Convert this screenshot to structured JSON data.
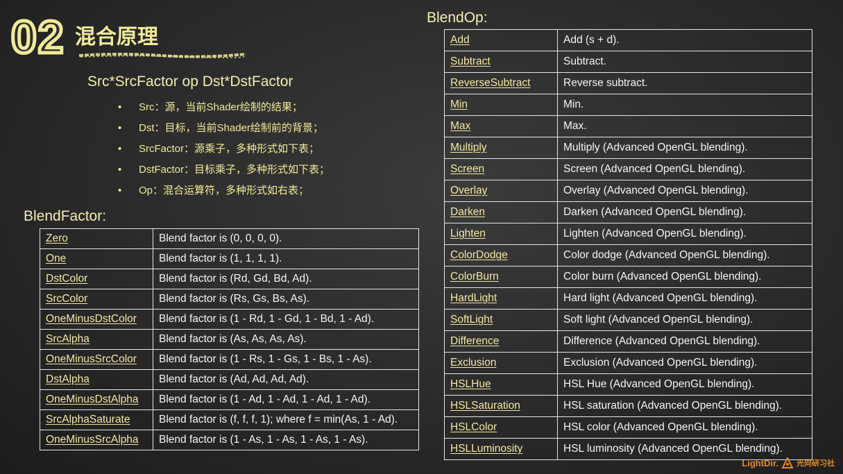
{
  "slide": {
    "number": "02",
    "title": "混合原理",
    "formula": "Src*SrcFactor  op  Dst*DstFactor",
    "bullets": [
      "Src：源，当前Shader绘制的结果；",
      "Dst：目标，当前Shader绘制前的背景；",
      "SrcFactor：源乘子，多种形式如下表；",
      "DstFactor：目标乘子，多种形式如下表；",
      "Op：混合运算符，多种形式如右表；"
    ],
    "bullet_symbol": "•"
  },
  "blend_factor": {
    "heading": "BlendFactor:",
    "rows": [
      {
        "name": "Zero",
        "desc": "Blend factor is (0, 0, 0, 0)."
      },
      {
        "name": "One",
        "desc": "Blend factor is (1, 1, 1, 1)."
      },
      {
        "name": "DstColor",
        "desc": "Blend factor is (Rd, Gd, Bd, Ad)."
      },
      {
        "name": "SrcColor",
        "desc": "Blend factor is (Rs, Gs, Bs, As)."
      },
      {
        "name": "OneMinusDstColor",
        "desc": "Blend factor is (1 - Rd, 1 - Gd, 1 - Bd, 1 - Ad)."
      },
      {
        "name": "SrcAlpha",
        "desc": "Blend factor is (As, As, As, As)."
      },
      {
        "name": "OneMinusSrcColor",
        "desc": "Blend factor is (1 - Rs, 1 - Gs, 1 - Bs, 1 - As)."
      },
      {
        "name": "DstAlpha",
        "desc": "Blend factor is (Ad, Ad, Ad, Ad)."
      },
      {
        "name": "OneMinusDstAlpha",
        "desc": "Blend factor is (1 - Ad, 1 - Ad, 1 - Ad, 1 - Ad)."
      },
      {
        "name": "SrcAlphaSaturate",
        "desc": "Blend factor is (f, f, f, 1); where f = min(As, 1 - Ad)."
      },
      {
        "name": "OneMinusSrcAlpha",
        "desc": "Blend factor is (1 - As, 1 - As, 1 - As, 1 - As)."
      }
    ]
  },
  "blend_op": {
    "heading": "BlendOp:",
    "rows": [
      {
        "name": "Add",
        "desc": "Add (s + d)."
      },
      {
        "name": "Subtract",
        "desc": "Subtract."
      },
      {
        "name": "ReverseSubtract",
        "desc": "Reverse subtract."
      },
      {
        "name": "Min",
        "desc": "Min."
      },
      {
        "name": "Max",
        "desc": "Max."
      },
      {
        "name": "Multiply",
        "desc": "Multiply (Advanced OpenGL blending)."
      },
      {
        "name": "Screen",
        "desc": "Screen (Advanced OpenGL blending)."
      },
      {
        "name": "Overlay",
        "desc": "Overlay (Advanced OpenGL blending)."
      },
      {
        "name": "Darken",
        "desc": "Darken (Advanced OpenGL blending)."
      },
      {
        "name": "Lighten",
        "desc": "Lighten (Advanced OpenGL blending)."
      },
      {
        "name": "ColorDodge",
        "desc": "Color dodge (Advanced OpenGL blending)."
      },
      {
        "name": "ColorBurn",
        "desc": "Color burn (Advanced OpenGL blending)."
      },
      {
        "name": "HardLight",
        "desc": "Hard light (Advanced OpenGL blending)."
      },
      {
        "name": "SoftLight",
        "desc": "Soft light (Advanced OpenGL blending)."
      },
      {
        "name": "Difference",
        "desc": "Difference (Advanced OpenGL blending)."
      },
      {
        "name": "Exclusion",
        "desc": "Exclusion (Advanced OpenGL blending)."
      },
      {
        "name": "HSLHue",
        "desc": "HSL Hue (Advanced OpenGL blending)."
      },
      {
        "name": "HSLSaturation",
        "desc": "HSL saturation (Advanced OpenGL blending)."
      },
      {
        "name": "HSLColor",
        "desc": "HSL color (Advanced OpenGL blending)."
      },
      {
        "name": "HSLLuminosity",
        "desc": "HSL luminosity (Advanced OpenGL blending)."
      }
    ]
  },
  "logo": {
    "latin": "LightDir.",
    "chinese": "光向研习社"
  },
  "colors": {
    "accent": "#f0ea9a",
    "background": "#2a2a2a",
    "logo": "#e28a2a"
  }
}
